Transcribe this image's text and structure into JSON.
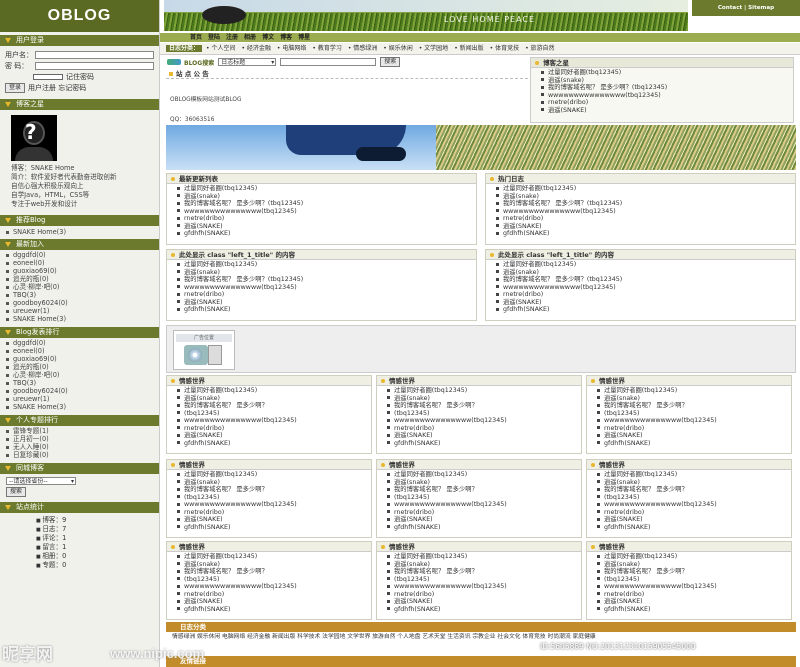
{
  "logo": "OBLOG",
  "top_links": "Contact | Sitemap",
  "slogan": "LOVE  HOME  PEACE",
  "nav": [
    "首页",
    "登陆",
    "注册",
    "相册",
    "博文",
    "博客",
    "博星"
  ],
  "categories": {
    "label": "日志分类：",
    "items": [
      "个人空间",
      "经济金融",
      "电脑网络",
      "教育学习",
      "情感绿洲",
      "娱乐休闲",
      "文学园地",
      "新闻出版",
      "体育竞技",
      "旅游自然"
    ]
  },
  "left": {
    "login": {
      "title": "用户登录",
      "user_label": "用户名：",
      "pass_label": "密  码：",
      "remember": "记住密码",
      "submit": "登录",
      "links": "用户注册  忘记密码"
    },
    "blogger": {
      "title": "博客之星",
      "lines": [
        "博客：SNAKE Home",
        "简介：软件爱好者代表勤奋进取创新",
        "自信心强大积极乐观向上",
        "自学Java，HTML，CSS等",
        "专注于web开发和设计"
      ]
    },
    "recommend": {
      "title": "推荐Blog",
      "items": [
        "SNAKE Home(3)"
      ]
    },
    "newjoin": {
      "title": "最新加入",
      "items": [
        "dggdfd(0)",
        "eoneel(0)",
        "guoxiao69(0)",
        "追光的瓶(0)",
        "心灵·柳岸·吧(0)",
        "TBQ(3)",
        "goodboy6024(0)",
        "ureuewr(1)",
        "SNAKE Home(3)"
      ]
    },
    "rank": {
      "title": "Blog发表排行",
      "items": [
        "dggdfd(0)",
        "eoneel(0)",
        "guoxiao69(0)",
        "追光的瓶(0)",
        "心灵·柳岸·吧(0)",
        "TBQ(3)",
        "goodboy6024(0)",
        "ureuewr(1)",
        "SNAKE Home(3)"
      ]
    },
    "topic": {
      "title": "个人专题排行",
      "items": [
        "雷锋专题(1)",
        "正月初一(0)",
        "无人入睡(0)",
        "日复珍藏(0)"
      ]
    },
    "search": {
      "title": "同城博客",
      "select": "--请选择省份--",
      "submit": "搜索"
    },
    "stats": {
      "title": "站点统计",
      "items": [
        "博客：9",
        "日志：7",
        "评论：1",
        "留言：1",
        "相册：0",
        "专题：0"
      ]
    }
  },
  "search": {
    "label": "BLOG搜索",
    "select": "日志标题",
    "submit": "搜索"
  },
  "notice": {
    "title": "站 点 公 告",
    "line1": "OBLOG模板网站测试BLOG",
    "line2": "QQ：36063516"
  },
  "visitor": {
    "title": "博客之星",
    "items": [
      "过量同好者圈(tbq12345)",
      "逍遥(snake)",
      "我的博客域名呢？ 是多少啊？(tbq12345)",
      "wwwwwwwwwwwwwww(tbq12345)",
      "rnetre(dribo)",
      "逍遥(SNAKE)"
    ]
  },
  "latest": {
    "title": "最新更新列表",
    "items": [
      "过量同好者圈(tbq12345)",
      "逍遥(snake)",
      "我的博客域名呢？ 是多少啊？(tbq12345)",
      "wwwwwwwwwwwwwww(tbq12345)",
      "rnetre(dribo)",
      "逍遥(SNAKE)",
      "gfdhfh(SNAKE)"
    ]
  },
  "hot": {
    "title": "热门日志",
    "items": [
      "过量同好者圈(tbq12345)",
      "逍遥(snake)",
      "我的博客域名呢？ 是多少啊？(tbq12345)",
      "wwwwwwwwwwwwwww(tbq12345)",
      "rnetre(dribo)",
      "逍遥(SNAKE)",
      "gfdhfh(SNAKE)"
    ]
  },
  "show": {
    "title": "此处显示  class \"left_1_title\" 的内容",
    "items": [
      "过量同好者圈(tbq12345)",
      "逍遥(snake)",
      "我的博客域名呢？ 是多少啊？(tbq12345)",
      "wwwwwwwwwwwwwww(tbq12345)",
      "rnetre(dribo)",
      "逍遥(SNAKE)",
      "gfdhfh(SNAKE)"
    ]
  },
  "ad_label": "广告位置",
  "grid": {
    "title": "情感世界",
    "items": [
      "过量同好者圈(tbq12345)",
      "逍遥(snake)",
      "我的博客域名呢？ 是多少啊？",
      "(tbq12345)",
      "wwwwwwwwwwwwwww(tbq12345)",
      "rnetre(dribo)",
      "逍遥(SNAKE)",
      "gfdhfh(SNAKE)"
    ]
  },
  "links": {
    "title": "日志分类",
    "text": "情感绿洲  娱乐休闲  电脑网络  经济金融  新闻出版  科学技术  法学园地  文学世界  旅游自然  个人地盘  艺术天堂  生活资讯  宗教企业  社会文化  体育竞技  时尚潮流  家庭健康"
  },
  "friend": "友情链接",
  "watermark": {
    "left": "昵享网",
    "url": "www.nipic.com",
    "id": "ID:5605889 NO:20131231015905545000"
  }
}
